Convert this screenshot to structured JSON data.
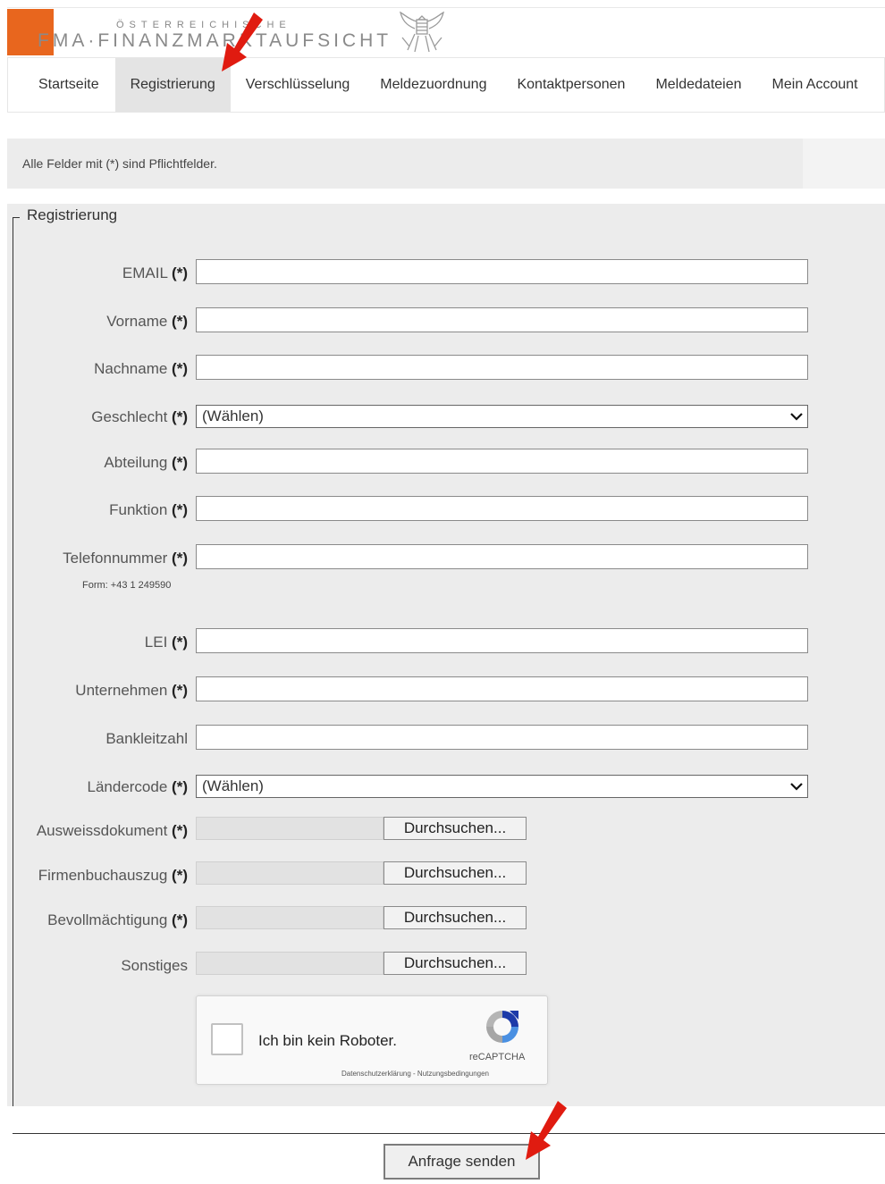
{
  "header": {
    "logo_small": "ÖSTERREICHISCHE",
    "logo_main": "FMA·FINANZMARKTAUFSICHT"
  },
  "nav": {
    "items": [
      {
        "label": "Startseite",
        "active": false
      },
      {
        "label": "Registrierung",
        "active": true
      },
      {
        "label": "Verschlüsselung",
        "active": false
      },
      {
        "label": "Meldezuordnung",
        "active": false
      },
      {
        "label": "Kontaktpersonen",
        "active": false
      },
      {
        "label": "Meldedateien",
        "active": false
      },
      {
        "label": "Mein Account",
        "active": false
      }
    ]
  },
  "info": {
    "text": "Alle Felder mit (*) sind Pflichtfelder."
  },
  "form": {
    "legend": "Registrierung",
    "required_marker": "(*)",
    "fields": {
      "email": {
        "label": "EMAIL",
        "value": ""
      },
      "vorname": {
        "label": "Vorname",
        "value": ""
      },
      "nachname": {
        "label": "Nachname",
        "value": ""
      },
      "geschlecht": {
        "label": "Geschlecht",
        "selected": "(Wählen)"
      },
      "abteilung": {
        "label": "Abteilung",
        "value": ""
      },
      "funktion": {
        "label": "Funktion",
        "value": ""
      },
      "telefon": {
        "label": "Telefonnummer",
        "value": "",
        "hint": "Form: +43 1 249590"
      },
      "lei": {
        "label": "LEI",
        "value": ""
      },
      "unternehmen": {
        "label": "Unternehmen",
        "value": ""
      },
      "bankleitzahl": {
        "label": "Bankleitzahl",
        "value": ""
      },
      "laendercode": {
        "label": "Ländercode",
        "selected": "(Wählen)"
      },
      "ausweis": {
        "label": "Ausweissdokument",
        "button": "Durchsuchen..."
      },
      "firmenbuch": {
        "label": "Firmenbuchauszug",
        "button": "Durchsuchen..."
      },
      "bevollmaechtigung": {
        "label": "Bevollmächtigung",
        "button": "Durchsuchen..."
      },
      "sonstiges": {
        "label": "Sonstiges",
        "button": "Durchsuchen..."
      }
    },
    "captcha": {
      "label": "Ich bin kein Roboter.",
      "brand": "reCAPTCHA",
      "links": "Datenschutzerklärung - Nutzungsbedingungen"
    },
    "submit_label": "Anfrage senden"
  },
  "colors": {
    "brand_orange": "#e8661e",
    "arrow_red": "#e01b10",
    "form_bg": "#ececec",
    "nav_active_bg": "#e4e4e4"
  }
}
